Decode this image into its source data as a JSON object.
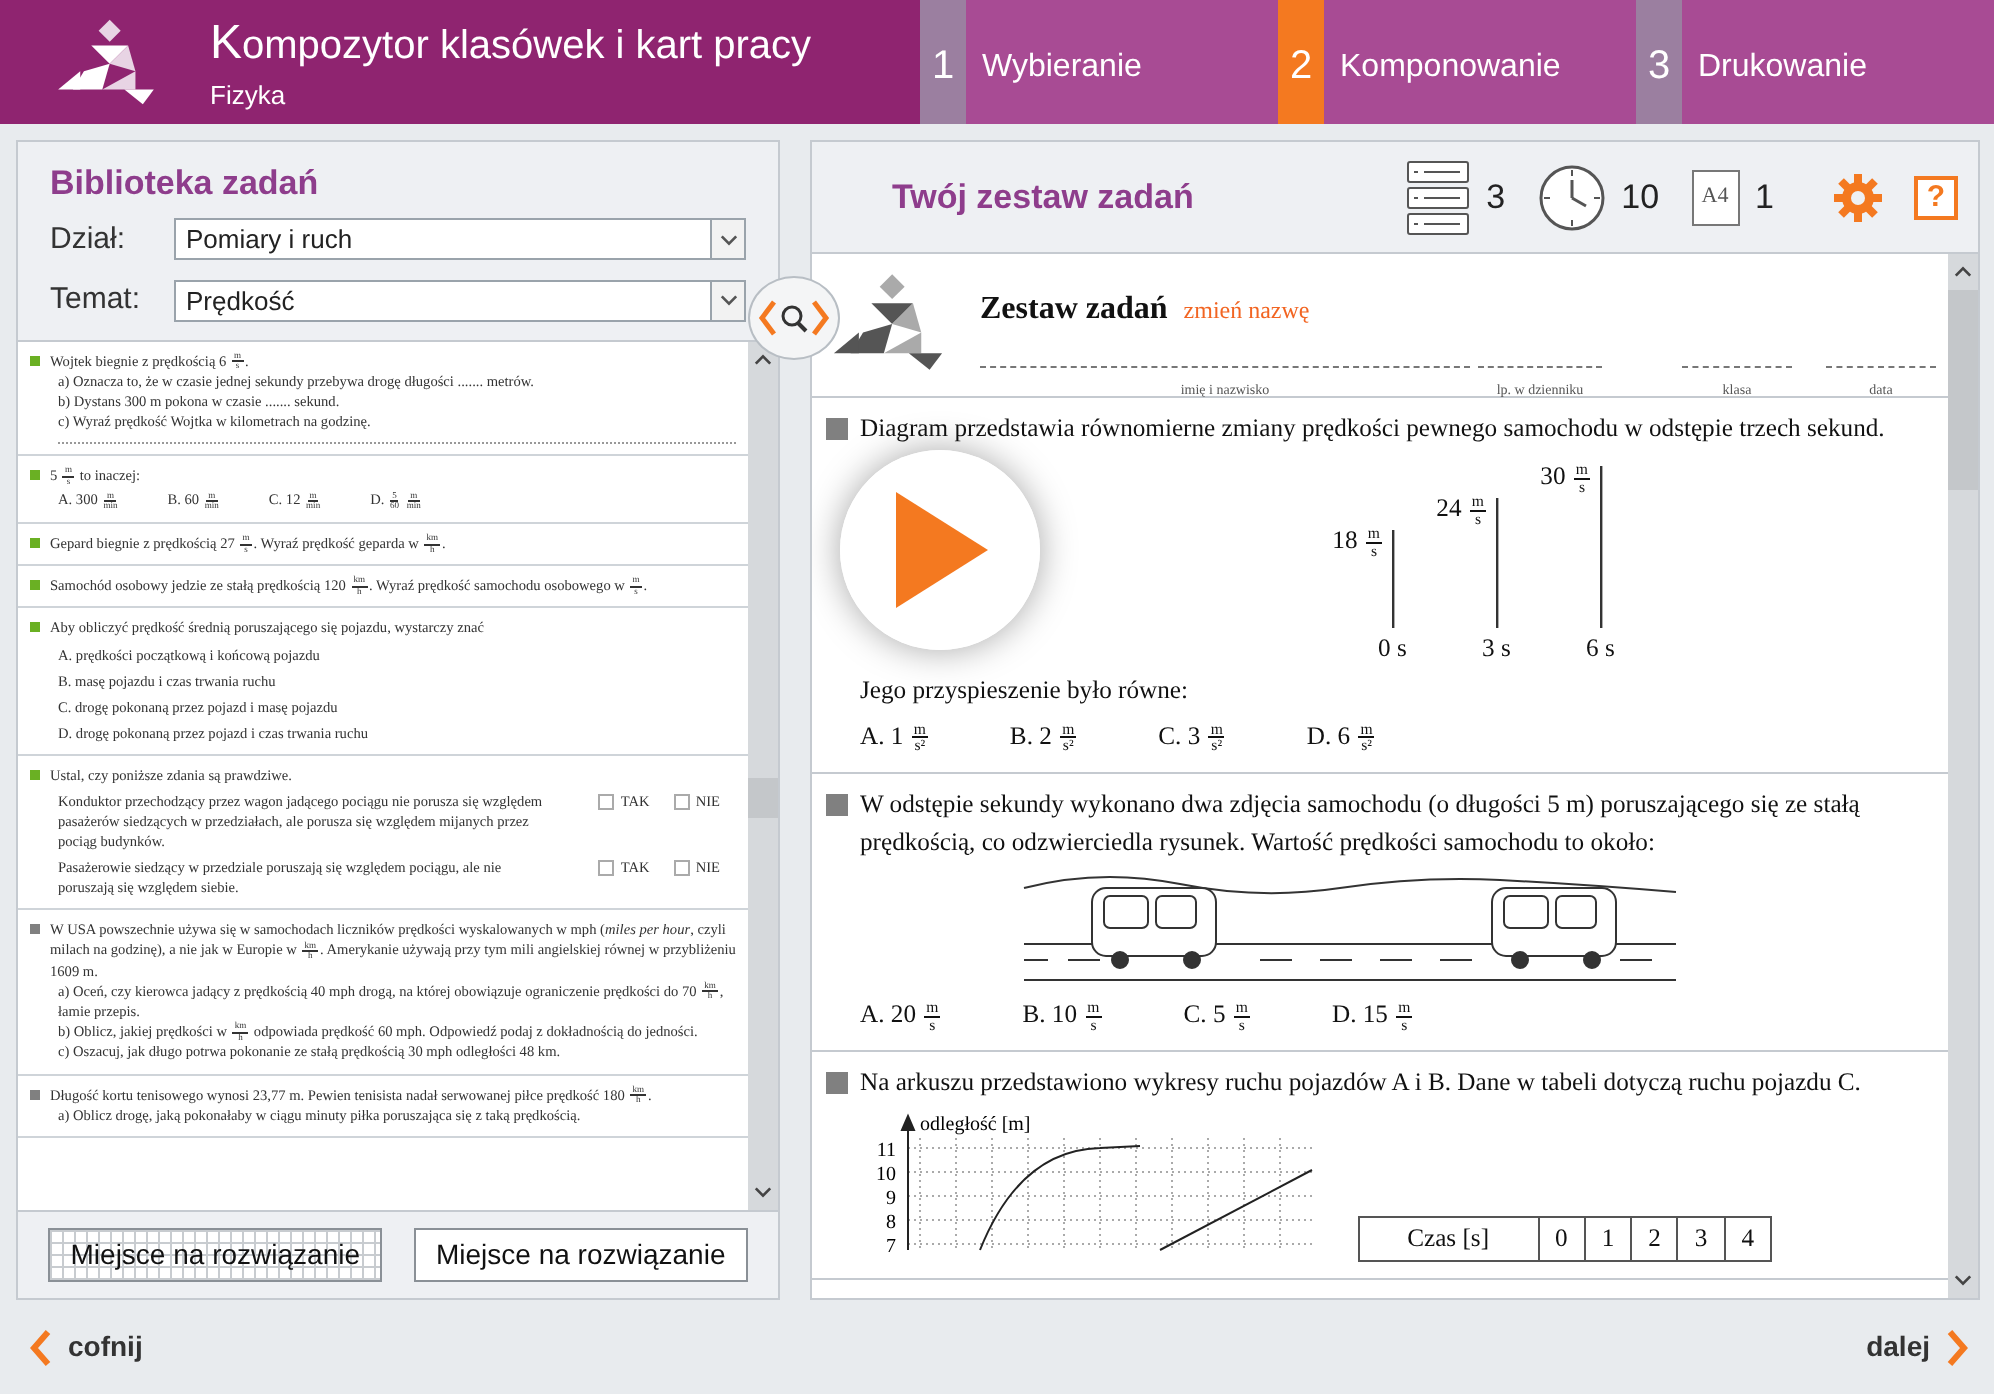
{
  "header": {
    "title": "Kompozytor klasówek i kart pracy",
    "subtitle": "Fizyka",
    "steps": [
      {
        "number": "1",
        "label": "Wybieranie",
        "selected": false
      },
      {
        "number": "2",
        "label": "Komponowanie",
        "selected": true
      },
      {
        "number": "3",
        "label": "Drukowanie",
        "selected": false
      }
    ]
  },
  "library": {
    "title": "Biblioteka zadań",
    "filters": [
      {
        "label": "Dział:",
        "value": "Pomiary i ruch"
      },
      {
        "label": "Temat:",
        "value": "Prędkość"
      }
    ],
    "tasks": [
      {
        "kind": "open",
        "color": "#6ab023",
        "text": "Wojtek biegnie z prędkością 6 $^{m}$$_{s}$.",
        "lines": [
          "a) Oznacza to, że w czasie jednej sekundy przebywa drogę długości ....... metrów.",
          "b) Dystans 300 m pokona w czasie ....... sekund.",
          "c) Wyraź prędkość Wojtka w kilometrach na godzinę."
        ]
      },
      {
        "kind": "choice",
        "color": "#6ab023",
        "text": "5 $^{m}$$_{s}$ to inaczej:",
        "options": [
          "A. 300 $^{m}$$_{min}$",
          "B. 60 $^{m}$$_{min}$",
          "C. 12 $^{m}$$_{min}$",
          "D. $^{5}$$_{60}$ $^{m}$$_{min}$"
        ]
      },
      {
        "kind": "text",
        "color": "#6ab023",
        "text": "Gepard biegnie z prędkością 27 $^{m}$$_{s}$. Wyraź prędkość geparda w $^{km}$$_{h}$."
      },
      {
        "kind": "text",
        "color": "#6ab023",
        "text": "Samochód osobowy jedzie ze stałą prędkością 120 $^{km}$$_{h}$. Wyraź prędkość samochodu osobowego w $^{m}$$_{s}$."
      },
      {
        "kind": "list",
        "color": "#6ab023",
        "text": "Aby obliczyć prędkość średnią poruszającego się pojazdu, wystarczy znać",
        "options": [
          "A. prędkości początkową i końcową pojazdu",
          "B. masę pojazdu i czas trwania ruchu",
          "C. drogę pokonaną przez pojazd i masę pojazdu",
          "D. drogę pokonaną przez pojazd i czas trwania ruchu"
        ]
      },
      {
        "kind": "truefalse",
        "color": "#6ab023",
        "text": "Ustal, czy poniższe zdania są prawdziwe.",
        "statements": [
          {
            "text": "Konduktor przechodzący przez wagon jadącego pociągu nie porusza się względem pasażerów siedzących w przedziałach, ale porusza się względem mijanych przez pociąg budynków.",
            "answers": [
              {
                "label": "TAK",
                "checked": false
              },
              {
                "label": "NIE",
                "checked": false
              }
            ]
          },
          {
            "text": "Pasażerowie siedzący w przedziale poruszają się względem pociągu, ale nie poruszają się względem siebie.",
            "answers": [
              {
                "label": "TAK",
                "checked": false
              },
              {
                "label": "NIE",
                "checked": false
              }
            ]
          }
        ]
      },
      {
        "kind": "text",
        "color": "#808080",
        "text": "W USA powszechnie używa się w samochodach liczników prędkości wyskalowanych w mph (*miles per hour*, czyli milach na godzinę), a nie jak w Europie w $^{km}$$_{h}$. Amerykanie używają przy tym mili angielskiej równej w przybliżeniu 1609 m.",
        "lines": [
          "a) Oceń, czy kierowca jadący z prędkością 40 mph drogą, na której obowiązuje ograniczenie prędkości do 70 $^{km}$$_{h}$, łamie przepis.",
          "b) Oblicz, jakiej prędkości w $^{km}$$_{h}$ odpowiada prędkość 60 mph. Odpowiedź podaj z dokładnością do jedności.",
          "c) Oszacuj, jak długo potrwa pokonanie ze stałą prędkością 30 mph odległości 48 km."
        ]
      },
      {
        "kind": "text",
        "color": "#808080",
        "text": "Długość kortu tenisowego wynosi 23,77 m. Pewien tenisista nadał serwowanej piłce prędkość 180 $^{km}$$_{h}$.",
        "lines": [
          "a) Oblicz drogę, jaką pokonałaby w ciągu minuty piłka poruszająca się z taką prędkością."
        ]
      }
    ],
    "buttons": [
      {
        "kind": "grid",
        "label": "Miejsce na rozwiązanie"
      },
      {
        "kind": "plain",
        "label": "Miejsce na rozwiązanie"
      }
    ]
  },
  "set": {
    "title": "Twój zestaw zadań",
    "stats": [
      {
        "kind": "tasks",
        "value": "3"
      },
      {
        "kind": "time",
        "value": "10"
      },
      {
        "kind": "pages",
        "format": "A4",
        "value": "1"
      }
    ],
    "help": "?",
    "sheet": {
      "title": "Zestaw zadań",
      "rename": "zmień nazwę",
      "fields": [
        "imię i nazwisko",
        "lp. w dzienniku",
        "klasa",
        "data"
      ],
      "tasks": [
        {
          "kind": "diagram",
          "text": "Diagram przedstawia równomierne zmiany prędkości pewnego samochodu w odstępie trzech sekund.",
          "chart_data": {
            "type": "bar",
            "categories": [
              "0 s",
              "3 s",
              "6 s"
            ],
            "values": [
              18,
              24,
              30
            ],
            "value_labels": [
              "18 $^{m}$$_{s}$",
              "24 $^{m}$$_{s}$",
              "30 $^{m}$$_{s}$"
            ]
          },
          "question": "Jego przyspieszenie było równe:",
          "options": [
            "A. 1 $^{m}$$_{s²}$",
            "B. 2 $^{m}$$_{s²}$",
            "C. 3 $^{m}$$_{s²}$",
            "D. 6 $^{m}$$_{s²}$"
          ]
        },
        {
          "kind": "picture",
          "text": "W odstępie sekundy wykonano dwa zdjęcia samochodu (o długości 5 m) poruszającego się ze stałą prędkością, co odzwierciedla rysunek. Wartość prędkości samochodu to około:",
          "options": [
            "A. 20 $^{m}$$_{s}$",
            "B. 10 $^{m}$$_{s}$",
            "C. 5 $^{m}$$_{s}$",
            "D. 15 $^{m}$$_{s}$"
          ]
        },
        {
          "kind": "graph",
          "text": "Na arkuszu przedstawiono wykresy ruchu pojazdów A i B. Dane w tabeli dotyczą ruchu pojazdu C.",
          "graph": {
            "ylabel": "odległość [m]",
            "yticks": [
              "11",
              "10",
              "9",
              "8",
              "7"
            ]
          },
          "table": {
            "columns": [
              "Czas [s]",
              "0",
              "1",
              "2",
              "3",
              "4"
            ]
          }
        }
      ]
    }
  },
  "footer": {
    "back": "cofnij",
    "next": "dalej"
  }
}
